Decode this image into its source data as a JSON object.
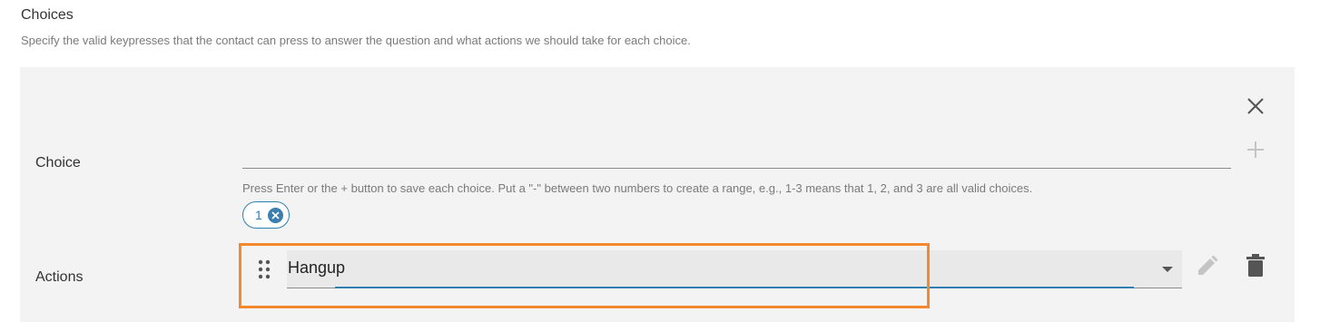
{
  "section": {
    "title": "Choices",
    "description": "Specify the valid keypresses that the contact can press to answer the question and what actions we should take for each choice."
  },
  "choice": {
    "label": "Choice",
    "input_value": "",
    "help_text": "Press Enter or the + button to save each choice. Put a \"-\" between two numbers to create a range, e.g., 1-3 means that 1, 2, and 3 are all valid choices.",
    "chips": [
      "1"
    ]
  },
  "actions": {
    "label": "Actions",
    "selected_value": "Hangup"
  },
  "icons": {
    "close": "close-icon",
    "add": "plus-icon",
    "chip_remove": "close-circle-icon",
    "drag": "drag-handle-icon",
    "caret": "chevron-down-icon",
    "edit": "pencil-icon",
    "delete": "trash-icon"
  },
  "colors": {
    "accent": "#2f80b0",
    "highlight": "#f5882d",
    "panel_bg": "#f3f3f3"
  }
}
